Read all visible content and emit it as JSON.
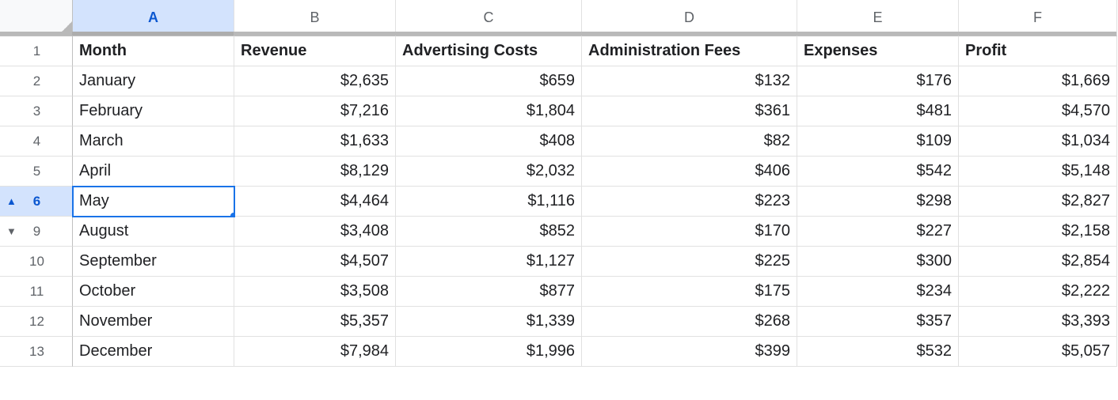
{
  "columns": [
    "A",
    "B",
    "C",
    "D",
    "E",
    "F"
  ],
  "selected_column": "A",
  "selected_row": "6",
  "active_cell": "A6",
  "header_row": {
    "A": "Month",
    "B": "Revenue",
    "C": "Advertising Costs",
    "D": "Administration Fees",
    "E": "Expenses",
    "F": "Profit"
  },
  "rows": [
    {
      "num": "1",
      "group_icon": null,
      "month": "Month",
      "rev": "Revenue",
      "adv": "Advertising Costs",
      "adm": "Administration Fees",
      "exp": "Expenses",
      "profit": "Profit",
      "is_header": true
    },
    {
      "num": "2",
      "group_icon": null,
      "month": "January",
      "rev": "$2,635",
      "adv": "$659",
      "adm": "$132",
      "exp": "$176",
      "profit": "$1,669"
    },
    {
      "num": "3",
      "group_icon": null,
      "month": "February",
      "rev": "$7,216",
      "adv": "$1,804",
      "adm": "$361",
      "exp": "$481",
      "profit": "$4,570"
    },
    {
      "num": "4",
      "group_icon": null,
      "month": "March",
      "rev": "$1,633",
      "adv": "$408",
      "adm": "$82",
      "exp": "$109",
      "profit": "$1,034"
    },
    {
      "num": "5",
      "group_icon": null,
      "month": "April",
      "rev": "$8,129",
      "adv": "$2,032",
      "adm": "$406",
      "exp": "$542",
      "profit": "$5,148"
    },
    {
      "num": "6",
      "group_icon": "up",
      "month": "May",
      "rev": "$4,464",
      "adv": "$1,116",
      "adm": "$223",
      "exp": "$298",
      "profit": "$2,827",
      "is_active": true
    },
    {
      "num": "9",
      "group_icon": "down",
      "month": "August",
      "rev": "$3,408",
      "adv": "$852",
      "adm": "$170",
      "exp": "$227",
      "profit": "$2,158"
    },
    {
      "num": "10",
      "group_icon": null,
      "month": "September",
      "rev": "$4,507",
      "adv": "$1,127",
      "adm": "$225",
      "exp": "$300",
      "profit": "$2,854"
    },
    {
      "num": "11",
      "group_icon": null,
      "month": "October",
      "rev": "$3,508",
      "adv": "$877",
      "adm": "$175",
      "exp": "$234",
      "profit": "$2,222"
    },
    {
      "num": "12",
      "group_icon": null,
      "month": "November",
      "rev": "$5,357",
      "adv": "$1,339",
      "adm": "$268",
      "exp": "$357",
      "profit": "$3,393"
    },
    {
      "num": "13",
      "group_icon": null,
      "month": "December",
      "rev": "$7,984",
      "adv": "$1,996",
      "adm": "$399",
      "exp": "$532",
      "profit": "$5,057"
    }
  ],
  "chart_data": {
    "type": "table",
    "columns": [
      "Month",
      "Revenue",
      "Advertising Costs",
      "Administration Fees",
      "Expenses",
      "Profit"
    ],
    "rows": [
      [
        "January",
        2635,
        659,
        132,
        176,
        1669
      ],
      [
        "February",
        7216,
        1804,
        361,
        481,
        4570
      ],
      [
        "March",
        1633,
        408,
        82,
        109,
        1034
      ],
      [
        "April",
        8129,
        2032,
        406,
        542,
        5148
      ],
      [
        "May",
        4464,
        1116,
        223,
        298,
        2827
      ],
      [
        "August",
        3408,
        852,
        170,
        227,
        2158
      ],
      [
        "September",
        4507,
        1127,
        225,
        300,
        2854
      ],
      [
        "October",
        3508,
        877,
        175,
        234,
        2222
      ],
      [
        "November",
        5357,
        1339,
        268,
        357,
        3393
      ],
      [
        "December",
        7984,
        1996,
        399,
        532,
        5057
      ]
    ],
    "hidden_rows": [
      7,
      8
    ]
  }
}
